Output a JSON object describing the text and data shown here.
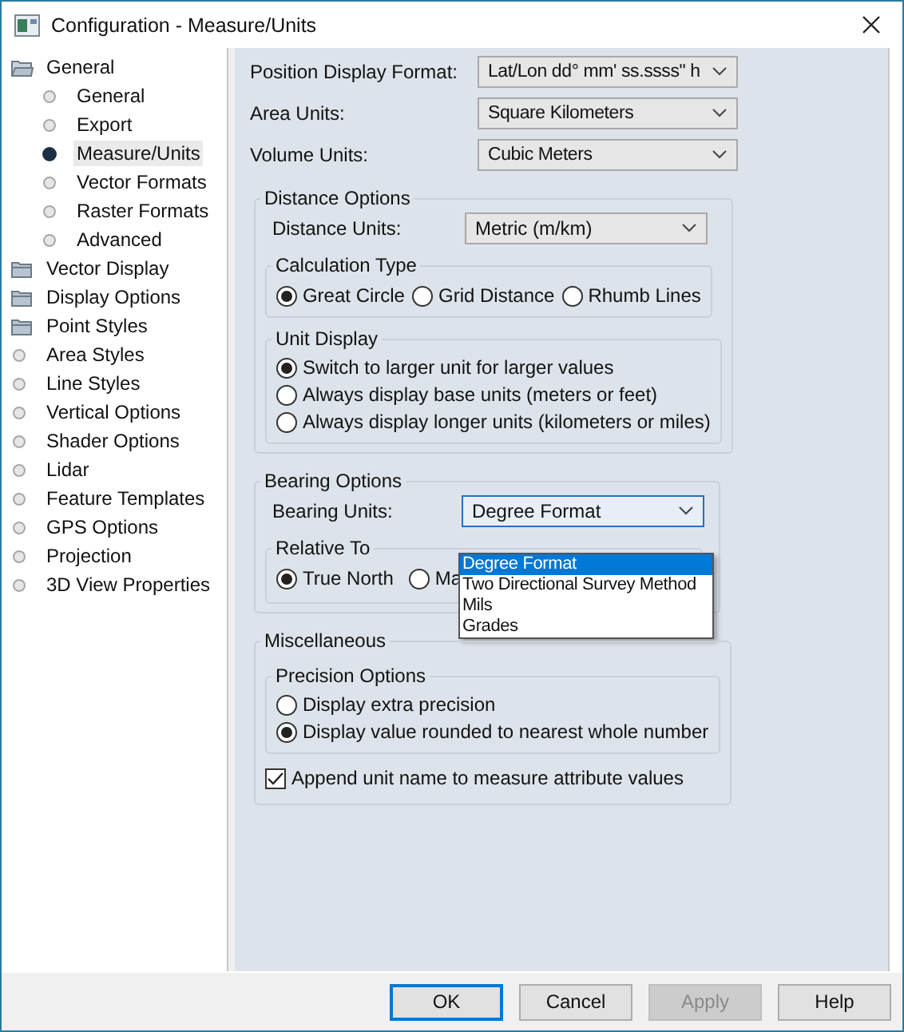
{
  "window": {
    "title": "Configuration - Measure/Units"
  },
  "tree": [
    {
      "label": "General",
      "kind": "folder",
      "expanded": true,
      "selected": false,
      "children": [
        {
          "label": "General",
          "kind": "leaf",
          "selected": false
        },
        {
          "label": "Export",
          "kind": "leaf",
          "selected": false
        },
        {
          "label": "Measure/Units",
          "kind": "leaf",
          "selected": true
        },
        {
          "label": "Vector Formats",
          "kind": "leaf",
          "selected": false
        },
        {
          "label": "Raster Formats",
          "kind": "leaf",
          "selected": false
        },
        {
          "label": "Advanced",
          "kind": "leaf",
          "selected": false
        }
      ]
    },
    {
      "label": "Vector Display",
      "kind": "folder",
      "expanded": false,
      "selected": false
    },
    {
      "label": "Display Options",
      "kind": "folder",
      "expanded": false,
      "selected": false
    },
    {
      "label": "Point Styles",
      "kind": "folder",
      "expanded": false,
      "selected": false
    },
    {
      "label": "Area Styles",
      "kind": "leaf",
      "selected": false
    },
    {
      "label": "Line Styles",
      "kind": "leaf",
      "selected": false
    },
    {
      "label": "Vertical Options",
      "kind": "leaf",
      "selected": false
    },
    {
      "label": "Shader Options",
      "kind": "leaf",
      "selected": false
    },
    {
      "label": "Lidar",
      "kind": "leaf",
      "selected": false
    },
    {
      "label": "Feature Templates",
      "kind": "leaf",
      "selected": false
    },
    {
      "label": "GPS Options",
      "kind": "leaf",
      "selected": false
    },
    {
      "label": "Projection",
      "kind": "leaf",
      "selected": false
    },
    {
      "label": "3D View Properties",
      "kind": "leaf",
      "selected": false
    }
  ],
  "fields": [
    {
      "label": "Position Display Format:",
      "value": "Lat/Lon dd° mm' ss.ssss\" h"
    },
    {
      "label": "Area Units:",
      "value": "Square Kilometers"
    },
    {
      "label": "Volume Units:",
      "value": "Cubic Meters"
    }
  ],
  "distance_options": {
    "title": "Distance Options",
    "units_label": "Distance Units:",
    "units_value": "Metric (m/km)",
    "calculation_type": {
      "title": "Calculation Type",
      "options": [
        {
          "label": "Great Circle",
          "selected": true
        },
        {
          "label": "Grid Distance",
          "selected": false
        },
        {
          "label": "Rhumb Lines",
          "selected": false
        }
      ]
    },
    "unit_display": {
      "title": "Unit Display",
      "options": [
        {
          "label": "Switch to larger unit for larger values",
          "selected": true
        },
        {
          "label": "Always display base units (meters or feet)",
          "selected": false
        },
        {
          "label": "Always display longer units (kilometers or miles)",
          "selected": false
        }
      ]
    }
  },
  "bearing_options": {
    "title": "Bearing Options",
    "units_label": "Bearing Units:",
    "units_value": "Degree Format",
    "open": true,
    "dropdown_items": [
      {
        "label": "Degree Format",
        "selected": true
      },
      {
        "label": "Two Directional Survey Method",
        "selected": false
      },
      {
        "label": "Mils",
        "selected": false
      },
      {
        "label": "Grades",
        "selected": false
      }
    ],
    "relative_to": {
      "title": "Relative To",
      "options": [
        {
          "label": "True North",
          "selected": true
        },
        {
          "label": "Ma",
          "selected": false
        }
      ]
    }
  },
  "miscellaneous": {
    "title": "Miscellaneous",
    "precision_options": {
      "title": "Precision Options",
      "options": [
        {
          "label": "Display extra precision",
          "selected": false
        },
        {
          "label": "Display value rounded to nearest whole number",
          "selected": true
        }
      ]
    },
    "append_unit": {
      "label": "Append unit name to measure attribute values",
      "checked": true
    }
  },
  "buttons": [
    {
      "label": "OK",
      "default": true,
      "disabled": false
    },
    {
      "label": "Cancel",
      "default": false,
      "disabled": false
    },
    {
      "label": "Apply",
      "default": false,
      "disabled": true
    },
    {
      "label": "Help",
      "default": false,
      "disabled": false
    }
  ]
}
